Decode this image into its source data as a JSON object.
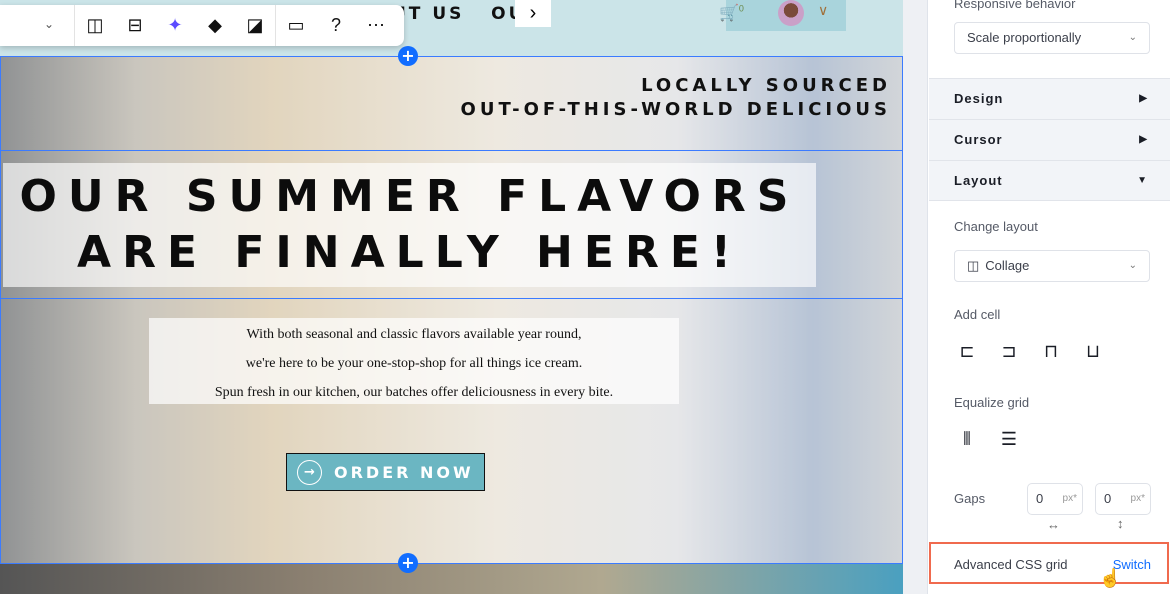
{
  "site": {
    "nav_text": "UT US   OU",
    "nav_arrow": "›",
    "cart_count": "0",
    "tagline": [
      "LOCALLY SOURCED",
      "OUT-OF-THIS-WORLD DELICIOUS"
    ],
    "headline": [
      "OUR SUMMER FLAVORS",
      "ARE FINALLY HERE!"
    ],
    "body": [
      "With both seasonal and classic flavors available year round,",
      "we're here to be your one-stop-shop for all things ice cream.",
      "Spun fresh in our kitchen, our batches offer deliciousness in every bite."
    ],
    "cta": "ORDER NOW",
    "accent": "#6bb6c2"
  },
  "toolbar": {
    "icons": [
      "add-column-icon",
      "add-row-icon",
      "ai-sparkle-icon",
      "animation-icon",
      "background-icon",
      "comment-icon",
      "help-icon",
      "more-icon"
    ]
  },
  "panel": {
    "responsive_label": "Responsive behavior",
    "responsive_value": "Scale proportionally",
    "sections": [
      "Design",
      "Cursor",
      "Layout"
    ],
    "change_layout_label": "Change layout",
    "layout_value": "Collage",
    "add_cell_label": "Add cell",
    "equalize_label": "Equalize grid",
    "gaps_label": "Gaps",
    "gap_h": "0",
    "gap_v": "0",
    "gap_unit": "px*",
    "advanced_label": "Advanced CSS grid",
    "switch_label": "Switch",
    "highlight_color": "#f06a4e",
    "link_color": "#116dff"
  }
}
